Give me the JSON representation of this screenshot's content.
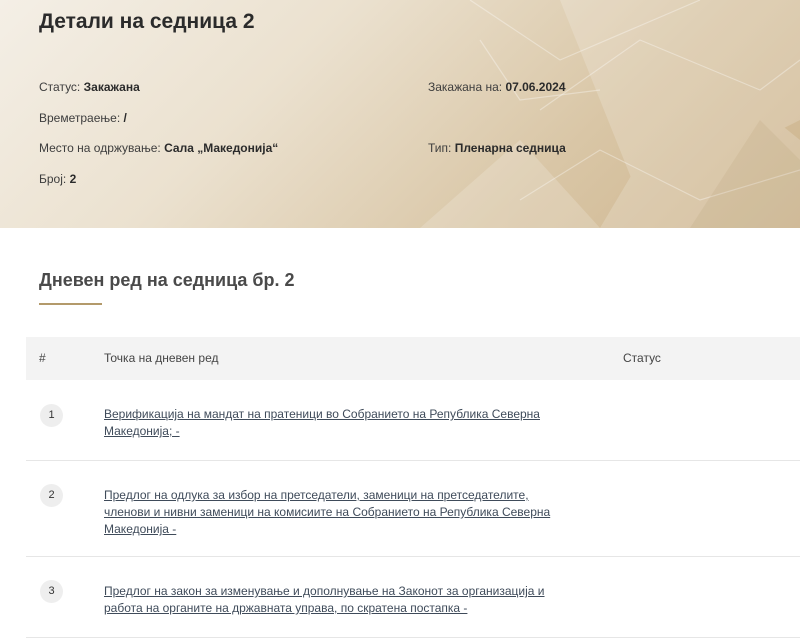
{
  "header": {
    "title": "Детали на седница 2",
    "status_label": "Статус:",
    "status_value": "Закажана",
    "scheduled_label": "Закажана на:",
    "scheduled_value": "07.06.2024",
    "duration_label": "Времетраење:",
    "duration_value": "/",
    "location_label": "Место на одржување:",
    "location_value": "Сала „Македонија“",
    "type_label": "Тип:",
    "type_value": "Пленарна седница",
    "number_label": "Број:",
    "number_value": "2"
  },
  "agenda": {
    "title": "Дневен ред на седница бр. 2",
    "columns": {
      "num": "#",
      "item": "Точка на дневен ред",
      "status": "Статус"
    },
    "items": [
      {
        "num": "1",
        "line1": "Верификација на мандат на пратеници во Собранието на Република Северна",
        "line2": "Македонија; -",
        "line3": ""
      },
      {
        "num": "2",
        "line1": "Предлог на одлука за избор на претседатели, заменици на претседателите,",
        "line2": "членови и нивни заменици на комисиите на Собранието на Република Северна",
        "line3": "Македонија -"
      },
      {
        "num": "3",
        "line1": "Предлог на закон за изменување и дополнување на Законот за организација и",
        "line2": "работа на органите на државната управа, по скратена постапка -",
        "line3": ""
      }
    ]
  },
  "colors": {
    "accent": "#b39a6b",
    "link": "#3f4b5a",
    "header_bg": "#f3f3f3"
  }
}
